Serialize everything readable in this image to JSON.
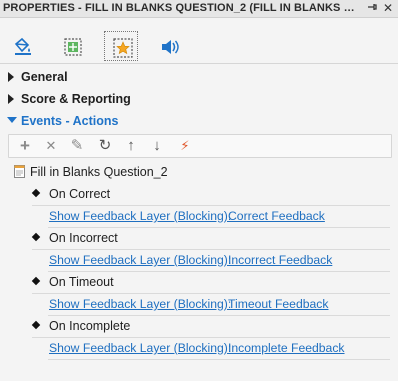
{
  "window": {
    "title": "PROPERTIES - FILL IN BLANKS QUESTION_2 (FILL IN BLANKS QUES...",
    "pin_icon": "pin-icon",
    "close_icon": "close-icon"
  },
  "tabs": [
    {
      "icon": "fill-bucket-icon"
    },
    {
      "icon": "transform-icon"
    },
    {
      "icon": "star-frame-icon",
      "active": true
    },
    {
      "icon": "speaker-icon"
    }
  ],
  "sections": {
    "general": "General",
    "score": "Score & Reporting",
    "events": "Events - Actions"
  },
  "toolbar": [
    {
      "icon": "add-icon",
      "glyph": "+"
    },
    {
      "icon": "delete-icon",
      "glyph": "✕"
    },
    {
      "icon": "edit-pencil-icon",
      "glyph": "✎"
    },
    {
      "icon": "refresh-icon",
      "glyph": "↻"
    },
    {
      "icon": "move-up-icon",
      "glyph": "↑"
    },
    {
      "icon": "move-down-icon",
      "glyph": "↓"
    },
    {
      "icon": "magic-wand-icon",
      "glyph": "⚡"
    }
  ],
  "tree": {
    "root_label": "Fill in Blanks Question_2",
    "events": [
      {
        "name": "On Correct",
        "action": "Show Feedback Layer (Blocking):",
        "target": "Correct Feedback"
      },
      {
        "name": "On Incorrect",
        "action": "Show Feedback Layer (Blocking):",
        "target": "Incorrect Feedback"
      },
      {
        "name": "On Timeout",
        "action": "Show Feedback Layer (Blocking):",
        "target": "Timeout Feedback"
      },
      {
        "name": "On Incomplete",
        "action": "Show Feedback Layer (Blocking):",
        "target": "Incomplete Feedback"
      }
    ]
  },
  "colors": {
    "accent": "#1f73c8",
    "link": "#1f6fc0",
    "background": "#f4f4f4"
  }
}
